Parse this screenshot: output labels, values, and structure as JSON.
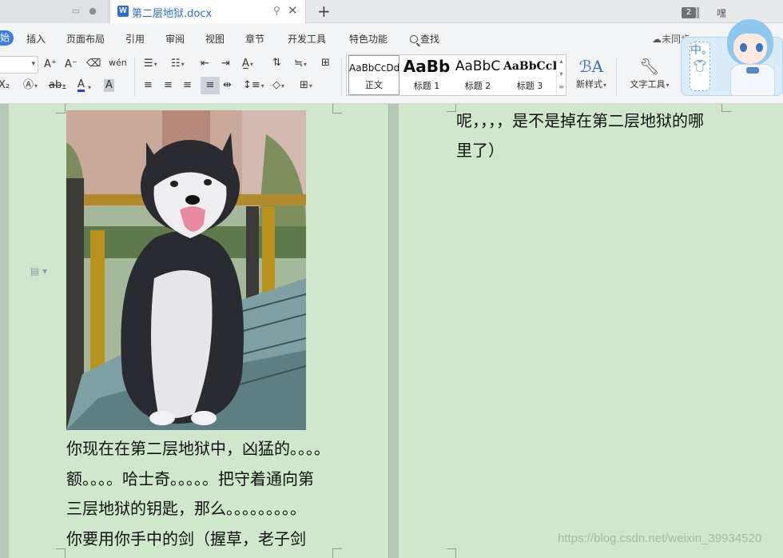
{
  "tabbar": {
    "active_tab_title": "第二层地狱.docx",
    "doc_icon_letter": "W",
    "new_tab_symbol": "+",
    "window_count": "2",
    "user_label": "嘿"
  },
  "menu": {
    "start_label": "始",
    "items": [
      "插入",
      "页面布局",
      "引用",
      "审阅",
      "视图",
      "章节",
      "开发工具",
      "特色功能"
    ],
    "search_label": "查找",
    "cloud_status": "未同步"
  },
  "toolbar": {
    "grow_font": "A⁺",
    "shrink_font": "A⁻",
    "phonetic": "wén",
    "styles": [
      {
        "sample": "AaBbCcDd",
        "name": "正文"
      },
      {
        "sample": "AaBb",
        "name": "标题 1"
      },
      {
        "sample": "AaBbC",
        "name": "标题 2"
      },
      {
        "sample": "AaBbCcI",
        "name": "标题 3"
      }
    ],
    "new_style_label": "新样式",
    "text_tools_label": "文字工具"
  },
  "mascot": {
    "badge_text": "中。"
  },
  "document": {
    "left_lines": [
      "你现在在第二层地狱中，凶猛的。。。。",
      "额。。。。哈士奇。。。。。把守着通向第",
      "三层地狱的钥匙，那么。。。。。。。。。",
      "你要用你手中的剑（握草，老子剑"
    ],
    "right_lines": [
      "呢，，，，是不是掉在第二层地狱的哪",
      "里了）"
    ],
    "watermark": "https://blog.csdn.net/weixin_39934520"
  },
  "colors": {
    "page_bg": "#cfe8cb",
    "accent": "#3d7ee6",
    "tab_title": "#2c6dd6"
  }
}
